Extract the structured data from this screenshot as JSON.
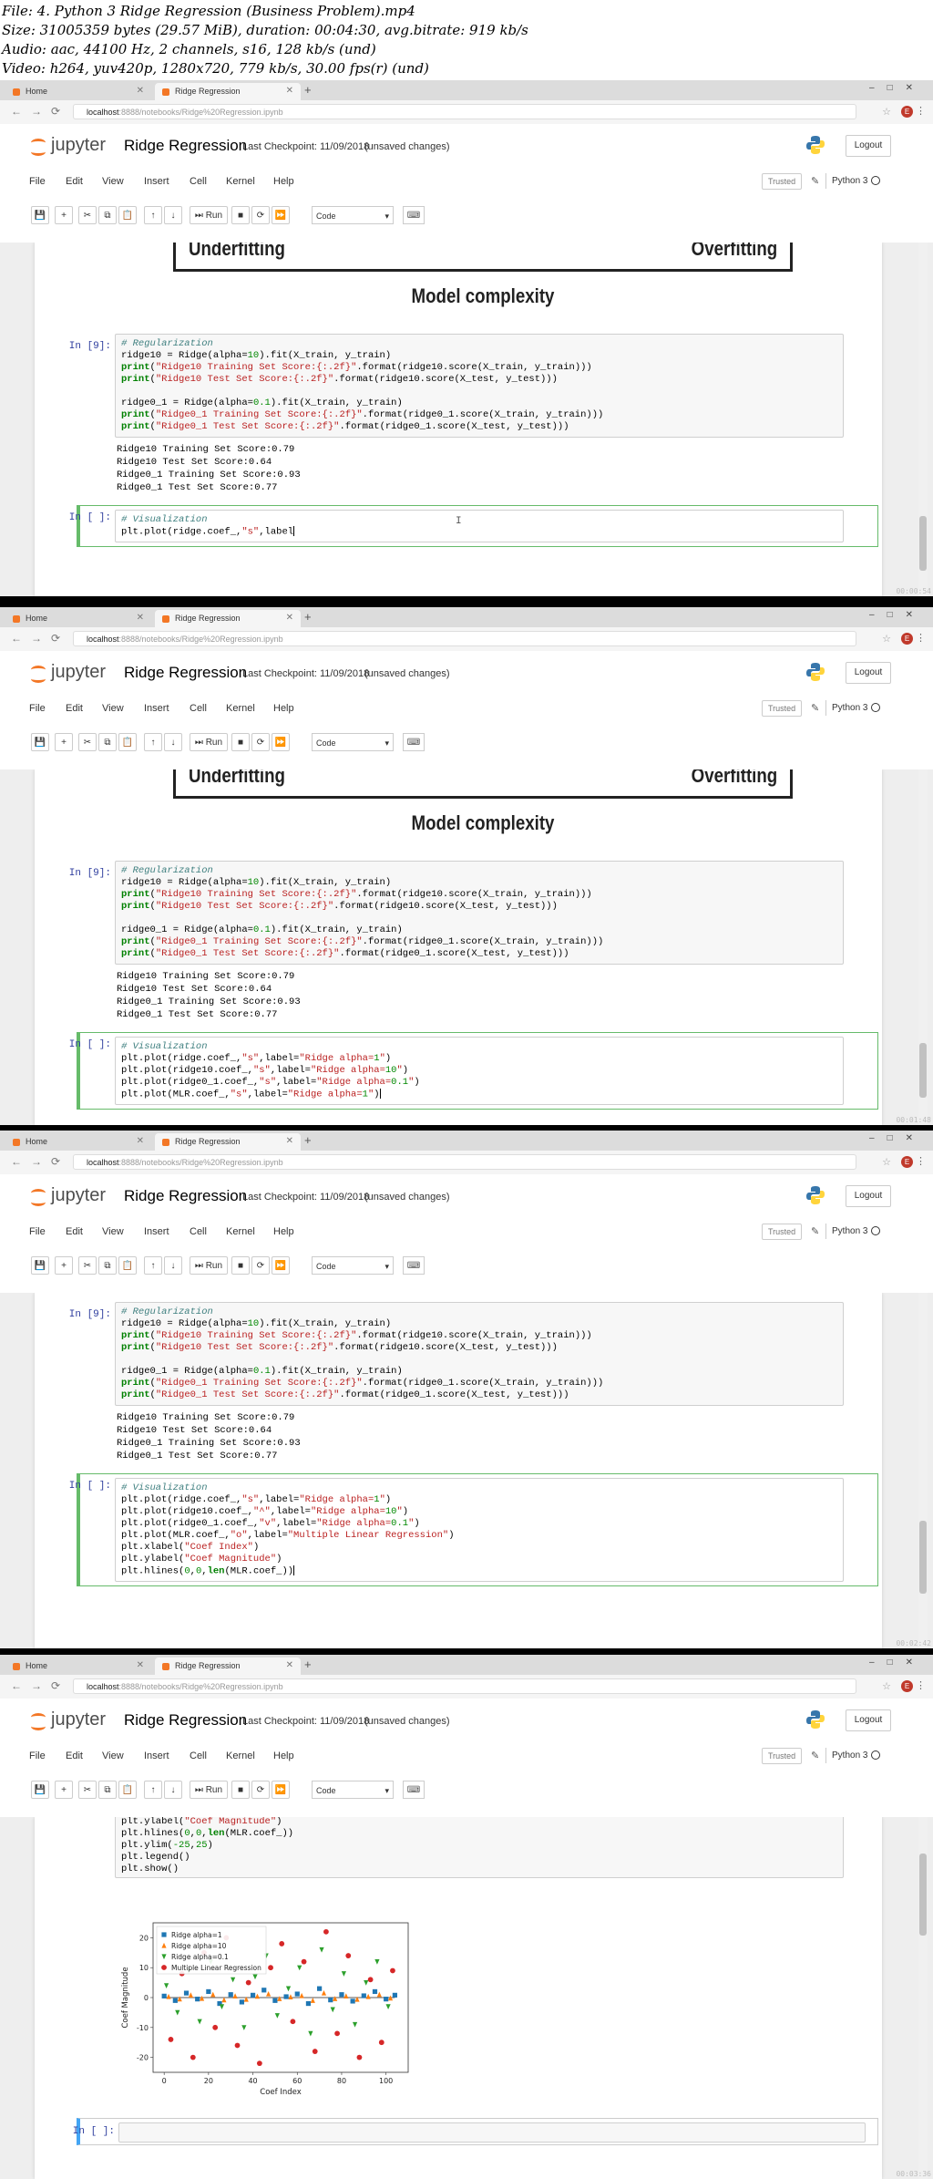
{
  "video_info": [
    "File: 4. Python 3 Ridge Regression (Business Problem).mp4",
    "Size: 31005359 bytes (29.57 MiB), duration: 00:04:30, avg.bitrate: 919 kb/s",
    "Audio: aac, 44100 Hz, 2 channels, s16, 128 kb/s (und)",
    "Video: h264, yuv420p, 1280x720, 779 kb/s, 30.00 fps(r) (und)"
  ],
  "browser": {
    "tab_home": "Home",
    "tab_active": "Ridge Regression",
    "url_host": "localhost",
    "url_path": ":8888/notebooks/Ridge%20Regression.ipynb",
    "profile_initial": "E"
  },
  "jupyter": {
    "logo_text": "jupyter",
    "notebook_title": "Ridge Regression",
    "checkpoint": "Last Checkpoint: 11/09/2018",
    "unsaved": "(unsaved changes)",
    "logout": "Logout",
    "menu": [
      "File",
      "Edit",
      "View",
      "Insert",
      "Cell",
      "Kernel",
      "Help"
    ],
    "trusted": "Trusted",
    "kernel_name": "Python 3",
    "run_label": "Run",
    "cell_type": "Code"
  },
  "figure_text": {
    "underfitting": "Underfitting",
    "overfitting": "Overfitting",
    "model_complexity": "Model complexity"
  },
  "cell_reg": {
    "prompt": "In [9]:",
    "lines": [
      "# Regularization",
      "ridge10 = Ridge(alpha=10).fit(X_train, y_train)",
      "print(\"Ridge10 Training Set Score:{:.2f}\".format(ridge10.score(X_train, y_train)))",
      "print(\"Ridge10 Test Set Score:{:.2f}\".format(ridge10.score(X_test, y_test)))",
      "",
      "ridge0_1 = Ridge(alpha=0.1).fit(X_train, y_train)",
      "print(\"Ridge0_1 Training Set Score:{:.2f}\".format(ridge0_1.score(X_train, y_train)))",
      "print(\"Ridge0_1 Test Set Score:{:.2f}\".format(ridge0_1.score(X_test, y_test)))"
    ],
    "output": [
      "Ridge10 Training Set Score:0.79",
      "Ridge10 Test Set Score:0.64",
      "Ridge0_1 Training Set Score:0.93",
      "Ridge0_1 Test Set Score:0.77"
    ]
  },
  "frames": [
    {
      "timestamp": "00:00:54",
      "viz_prompt": "In [ ]:",
      "viz_lines": [
        "# Visualization",
        "plt.plot(ridge.coef_,\"s\",label"
      ]
    },
    {
      "timestamp": "00:01:48",
      "viz_prompt": "In [ ]:",
      "viz_lines": [
        "# Visualization",
        "plt.plot(ridge.coef_,\"s\",label=\"Ridge alpha=1\")",
        "plt.plot(ridge10.coef_,\"s\",label=\"Ridge alpha=10\")",
        "plt.plot(ridge0_1.coef_,\"s\",label=\"Ridge alpha=0.1\")",
        "plt.plot(MLR.coef_,\"s\",label=\"Ridge alpha=1\")"
      ]
    },
    {
      "timestamp": "00:02:42",
      "viz_prompt": "In [ ]:",
      "viz_lines": [
        "# Visualization",
        "plt.plot(ridge.coef_,\"s\",label=\"Ridge alpha=1\")",
        "plt.plot(ridge10.coef_,\"^\",label=\"Ridge alpha=10\")",
        "plt.plot(ridge0_1.coef_,\"v\",label=\"Ridge alpha=0.1\")",
        "plt.plot(MLR.coef_,\"o\",label=\"Multiple Linear Regression\")",
        "plt.xlabel(\"Coef Index\")",
        "plt.ylabel(\"Coef Magnitude\")",
        "plt.hlines(0,0,len(MLR.coef_))"
      ]
    },
    {
      "timestamp": "00:03:36",
      "viz_prompt": "In [ ]:",
      "viz_lines": [
        "plt.ylabel(\"Coef Magnitude\")",
        "plt.hlines(0,0,len(MLR.coef_))",
        "plt.ylim(-25,25)",
        "plt.legend()",
        "plt.show()"
      ]
    }
  ],
  "chart_data": {
    "type": "scatter",
    "xlabel": "Coef Index",
    "ylabel": "Coef Magnitude",
    "xlim": [
      -5,
      110
    ],
    "ylim": [
      -25,
      25
    ],
    "xticks": [
      0,
      20,
      40,
      60,
      80,
      100
    ],
    "yticks": [
      -20,
      -10,
      0,
      10,
      20
    ],
    "legend_position": "top-left",
    "hline": 0,
    "series": [
      {
        "name": "Ridge alpha=1",
        "marker": "square",
        "color": "#1f77b4",
        "x": [
          0,
          5,
          10,
          15,
          20,
          25,
          30,
          35,
          40,
          45,
          50,
          55,
          60,
          65,
          70,
          75,
          80,
          85,
          90,
          95,
          100,
          104
        ],
        "y": [
          0.5,
          -1,
          1.5,
          -0.5,
          2,
          -2,
          1,
          -1.5,
          0.8,
          2.5,
          -1,
          0.3,
          1.2,
          -2,
          3,
          -0.8,
          1,
          -1.2,
          0.6,
          2,
          -0.5,
          0.8
        ]
      },
      {
        "name": "Ridge alpha=10",
        "marker": "triangle-up",
        "color": "#ff7f0e",
        "x": [
          2,
          7,
          12,
          17,
          22,
          27,
          32,
          37,
          42,
          47,
          52,
          57,
          62,
          67,
          72,
          77,
          82,
          87,
          92,
          97,
          102
        ],
        "y": [
          0.3,
          -0.5,
          0.8,
          -0.3,
          1,
          -0.8,
          0.5,
          -0.6,
          0.4,
          1.2,
          -0.4,
          0.2,
          0.6,
          -1,
          1.5,
          -0.4,
          0.5,
          -0.6,
          0.3,
          1,
          -0.2
        ]
      },
      {
        "name": "Ridge alpha=0.1",
        "marker": "triangle-down",
        "color": "#2ca02c",
        "x": [
          1,
          6,
          11,
          16,
          21,
          26,
          31,
          36,
          41,
          46,
          51,
          56,
          61,
          66,
          71,
          76,
          81,
          86,
          91,
          96,
          101
        ],
        "y": [
          4,
          -5,
          9,
          -8,
          12,
          -3,
          6,
          -10,
          7,
          14,
          -6,
          3,
          10,
          -12,
          16,
          -4,
          8,
          -9,
          5,
          12,
          -3
        ]
      },
      {
        "name": "Multiple Linear Regression",
        "marker": "circle",
        "color": "#d62728",
        "x": [
          3,
          8,
          13,
          18,
          23,
          28,
          33,
          38,
          43,
          48,
          53,
          58,
          63,
          68,
          73,
          78,
          83,
          88,
          93,
          98,
          103
        ],
        "y": [
          -14,
          8,
          -20,
          15,
          -10,
          20,
          -16,
          5,
          -22,
          10,
          18,
          -8,
          12,
          -18,
          22,
          -12,
          14,
          -20,
          6,
          -15,
          9
        ]
      }
    ]
  }
}
